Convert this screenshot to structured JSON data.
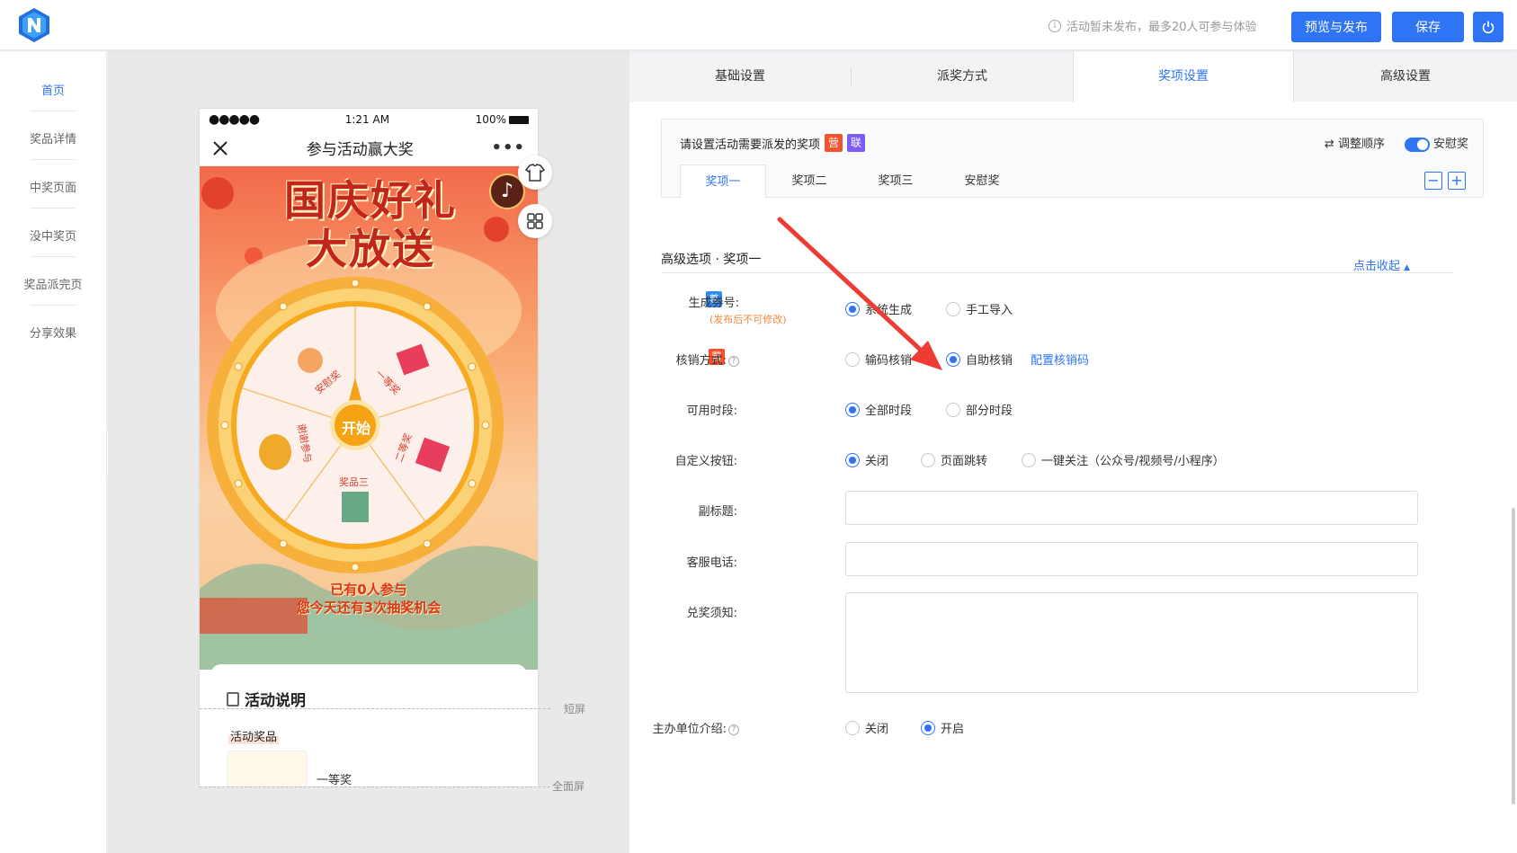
{
  "header": {
    "notice": "活动暂未发布，最多20人可参与体验",
    "publish_label": "预览与发布",
    "save_label": "保存"
  },
  "nav": {
    "items": [
      {
        "label": "首页"
      },
      {
        "label": "奖品详情"
      },
      {
        "label": "中奖页面"
      },
      {
        "label": "没中奖页"
      },
      {
        "label": "奖品派完页"
      },
      {
        "label": "分享效果"
      }
    ]
  },
  "phone": {
    "time": "1:21 AM",
    "battery": "100%",
    "title": "参与活动赢大奖",
    "headline_1": "国庆好礼",
    "headline_2": "大放送",
    "start_label": "开始",
    "wheel_prizes": [
      "安慰奖",
      "一等奖",
      "二等奖",
      "奖品三",
      "谢谢参与"
    ],
    "participants": "已有0人参与",
    "chances": "您今天还有3次抽奖机会",
    "desc_title": "活动说明",
    "desc_tag": "活动奖品",
    "prize_name": "一等奖"
  },
  "screen_marks": {
    "short": "短屏",
    "full": "全面屏"
  },
  "tabs": [
    {
      "label": "基础设置"
    },
    {
      "label": "派奖方式"
    },
    {
      "label": "奖项设置"
    },
    {
      "label": "高级设置"
    }
  ],
  "prize_box": {
    "title": "请设置活动需要派发的奖项",
    "badge_ying": "营",
    "badge_lian": "联",
    "reorder_label": "调整顺序",
    "consolation_toggle": "安慰奖",
    "prize_tabs": [
      "奖项一",
      "奖项二",
      "奖项三",
      "安慰奖"
    ]
  },
  "advanced": {
    "section_title": "高级选项 · 奖项一",
    "collapse_label": "点击收起",
    "rows": {
      "coupon": {
        "label": "生成券号:",
        "badge": "尊",
        "hint": "(发布后不可修改)",
        "options": [
          "系统生成",
          "手工导入"
        ]
      },
      "verify": {
        "label": "核销方式:",
        "badge": "营",
        "options": [
          "输码核销",
          "自助核销"
        ],
        "link": "配置核销码"
      },
      "period": {
        "label": "可用时段:",
        "options": [
          "全部时段",
          "部分时段"
        ]
      },
      "custom_button": {
        "label": "自定义按钮:",
        "options": [
          "关闭",
          "页面跳转",
          "一键关注（公众号/视频号/小程序）"
        ]
      },
      "subtitle": {
        "label": "副标题:"
      },
      "phone": {
        "label": "客服电话:"
      },
      "notice": {
        "label": "兑奖须知:"
      },
      "organizer": {
        "label": "主办单位介绍:",
        "options": [
          "关闭",
          "开启"
        ]
      }
    }
  }
}
